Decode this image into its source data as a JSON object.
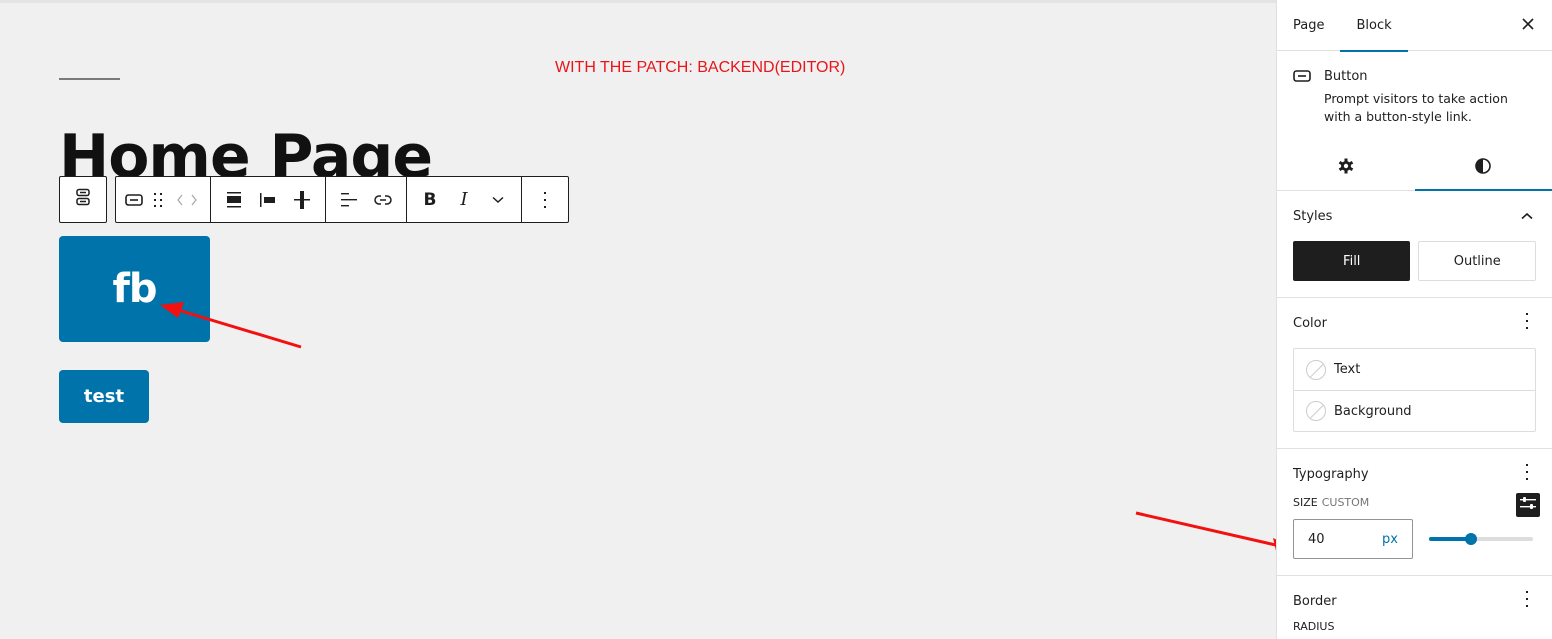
{
  "editor": {
    "patch_note": "WITH THE PATCH: BACKEND(EDITOR)",
    "page_title": "Home Page",
    "buttons": [
      {
        "label": "fb",
        "font_size_px": 40
      },
      {
        "label": "test"
      }
    ],
    "toolbar": {
      "parent_icon": "buttons-parent-icon",
      "groups": [
        [
          "button-block-icon",
          "drag-handle-icon",
          "move-arrows-icon"
        ],
        [
          "justify-icon",
          "align-left-icon",
          "vertical-align-icon"
        ],
        [
          "text-align-icon",
          "link-icon"
        ],
        [
          "bold-icon",
          "italic-icon",
          "chevron-down-icon"
        ],
        [
          "more-options-icon"
        ]
      ],
      "bold_label": "B",
      "italic_label": "I"
    },
    "colors": {
      "accent": "#0073aa",
      "annotation": "#e8161b",
      "canvas_bg": "#f0f0f0"
    }
  },
  "sidebar": {
    "tabs": [
      {
        "label": "Page",
        "active": false
      },
      {
        "label": "Block",
        "active": true
      }
    ],
    "block": {
      "name": "Button",
      "description": "Prompt visitors to take action with a button-style link."
    },
    "subtabs": [
      {
        "icon": "gear-icon",
        "active": false
      },
      {
        "icon": "contrast-icon",
        "active": true
      }
    ],
    "styles": {
      "title": "Styles",
      "options": [
        {
          "label": "Fill",
          "selected": true
        },
        {
          "label": "Outline",
          "selected": false
        }
      ]
    },
    "color": {
      "title": "Color",
      "items": [
        {
          "label": "Text"
        },
        {
          "label": "Background"
        }
      ]
    },
    "typography": {
      "title": "Typography",
      "size_label": "SIZE",
      "size_mode": "CUSTOM",
      "size_value": "40",
      "unit": "px",
      "slider_fraction": 0.4
    },
    "border": {
      "title": "Border",
      "radius_label": "RADIUS"
    }
  }
}
